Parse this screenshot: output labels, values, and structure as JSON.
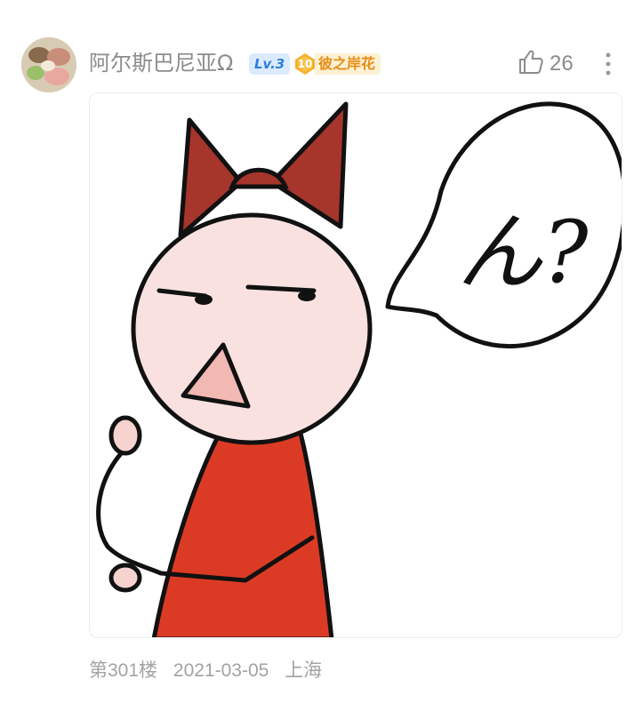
{
  "post": {
    "username": "阿尔斯巴尼亚Ω",
    "level_badge": "Lv.3",
    "fan_badge": {
      "level": "10",
      "name": "彼之岸花"
    },
    "likes": "26",
    "image": {
      "speech_text": "ん?"
    },
    "footer": {
      "floor": "第301楼",
      "date": "2021-03-05",
      "location": "上海"
    }
  },
  "colors": {
    "username": "#8c8c8c",
    "level_badge_bg": "#dbeafc",
    "level_badge_text": "#2d7fe0",
    "fan_badge_bg": "#fdf1d3",
    "fan_badge_text": "#e98b14",
    "footer_text": "#a3a3a3"
  },
  "icons": {
    "like": "thumbs-up-icon",
    "more": "more-vertical-icon",
    "medal": "medal-icon"
  }
}
